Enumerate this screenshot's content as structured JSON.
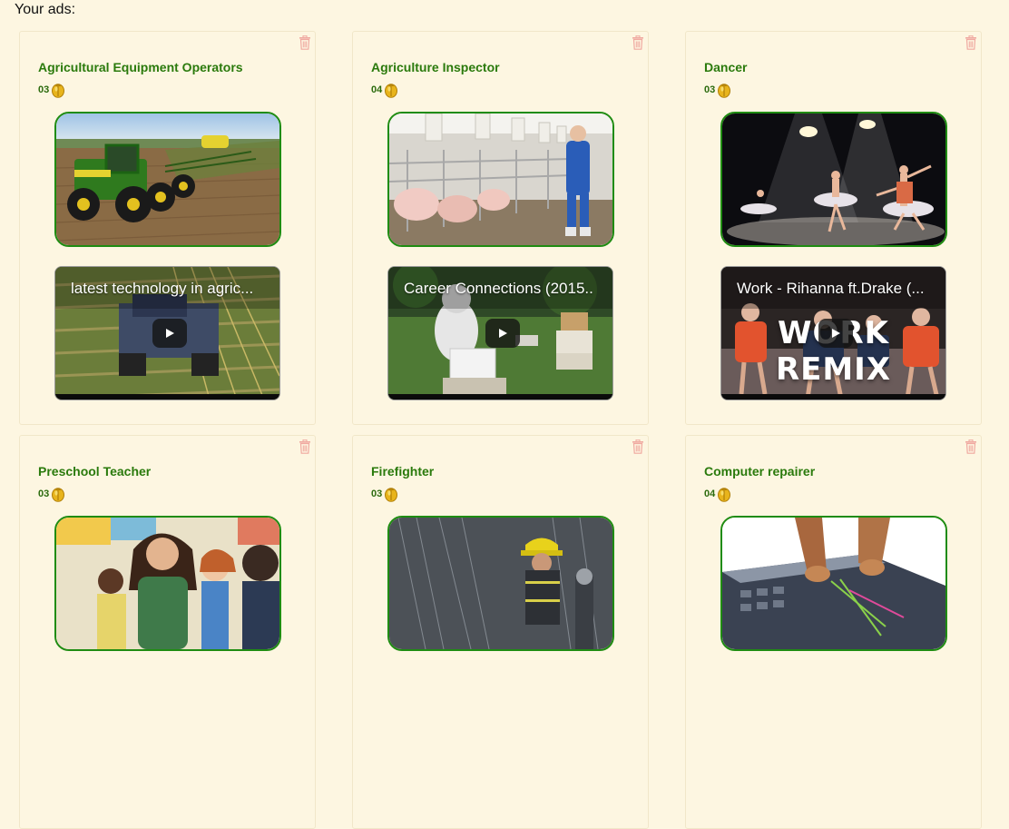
{
  "page": {
    "heading": "Your ads:"
  },
  "colors": {
    "background": "#fdf6e1",
    "title_green": "#2a7a0c",
    "image_border": "#1f8c12",
    "trash_icon": "#f0a9a0",
    "coin": "#e8b41c"
  },
  "ads": [
    {
      "title": "Agricultural Equipment Operators",
      "coins": "03",
      "image": "tractor-in-field",
      "video_title": "latest technology in agric...",
      "video_overlay": ""
    },
    {
      "title": "Agriculture Inspector",
      "coins": "04",
      "image": "inspector-in-pig-barn",
      "video_title": "Career Connections (2015..",
      "video_overlay": ""
    },
    {
      "title": "Dancer",
      "coins": "03",
      "image": "ballet-dancers-on-stage",
      "video_title": "Work - Rihanna ft.Drake (...",
      "video_overlay": "WORK REMIX"
    },
    {
      "title": "Preschool Teacher",
      "coins": "03",
      "image": "teacher-with-children"
    },
    {
      "title": "Firefighter",
      "coins": "03",
      "image": "firefighter-with-hose"
    },
    {
      "title": "Computer repairer",
      "coins": "04",
      "image": "hands-inside-computer-case"
    }
  ]
}
